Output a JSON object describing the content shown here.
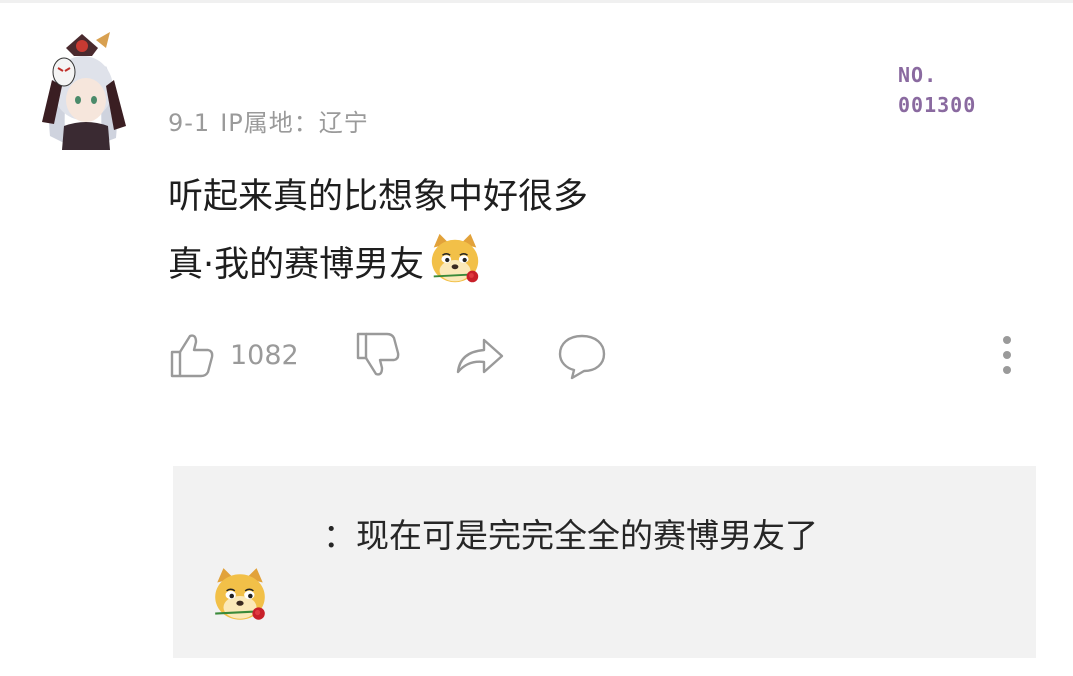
{
  "comment": {
    "date": "9-1",
    "ip_label": "IP属地：辽宁",
    "line1": "听起来真的比想象中好很多",
    "line2": "真·我的赛博男友"
  },
  "watermark": {
    "line1": "NO.",
    "line2": "001300"
  },
  "actions": {
    "like_count": "1082",
    "icons": [
      "thumbs-up-icon",
      "thumbs-down-icon",
      "share-icon",
      "reply-bubble-icon",
      "more-vertical-icon"
    ]
  },
  "reply": {
    "text": "：现在可是完完全全的赛博男友了"
  },
  "emoji": {
    "name": "doge-rose-emoji"
  },
  "colors": {
    "meta_text": "#9a9a9a",
    "watermark": "#8a6aa0",
    "reply_bg": "#f2f2f2",
    "icon_stroke": "#9a9a9a"
  }
}
